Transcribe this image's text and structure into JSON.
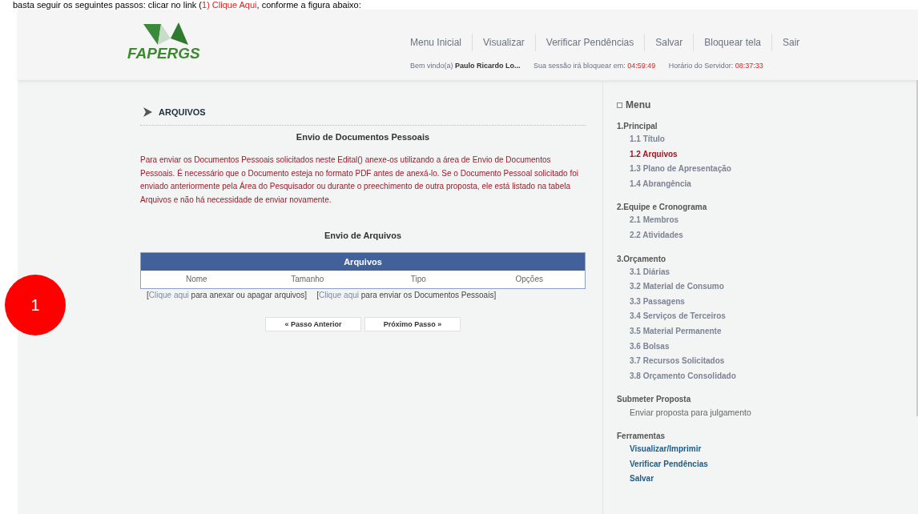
{
  "caption": {
    "before": "basta seguir os seguintes passos: clicar no link (",
    "link": "1) Clique Aqui",
    "after": ", conforme a figura abaixo:"
  },
  "header": {
    "logo": "FAPERGS",
    "nav": [
      "Menu Inicial",
      "Visualizar",
      "Verificar Pendências",
      "Salvar",
      "Bloquear tela",
      "Sair"
    ],
    "welcome_label": "Bem vindo(a)",
    "user": "Paulo Ricardo Lo...",
    "session_label": "Sua sessão irá bloquear em:",
    "session_time": "04:59:49",
    "server_label": "Horário do Servidor:",
    "server_time": "08:37:33"
  },
  "main": {
    "section_title": "ARQUIVOS",
    "subtitle": "Envio de Documentos Pessoais",
    "notice": "Para enviar os Documentos Pessoais solicitados neste Edital() anexe-os utilizando a área de Envio de Documentos Pessoais. É necessário que o Documento esteja no formato PDF antes de anexá-lo. Se o Documento Pessoal solicitado foi enviado anteriormente pela Área do Pesquisador ou durante o preechimento de outra proposta, ele está listado na tabela Arquivos e não há necessidade de enviar novamente.",
    "files_title": "Envio de Arquivos",
    "table": {
      "title": "Arquivos",
      "columns": [
        "Nome",
        "Tamanho",
        "Tipo",
        "Opções"
      ]
    },
    "links": [
      {
        "open": "[",
        "link": "Clique aqui",
        "text": " para anexar ou apagar arquivos]"
      },
      {
        "open": "[",
        "link": "Clique aqui",
        "text": " para enviar os Documentos Pessoais]"
      }
    ],
    "buttons": [
      "« Passo Anterior",
      "Próximo Passo »"
    ]
  },
  "sidebar": {
    "title": "Menu",
    "groups": [
      {
        "label": "1.Principal",
        "items": [
          {
            "label": "1.1 Título",
            "kind": "step",
            "selected": false
          },
          {
            "label": "1.2 Arquivos",
            "kind": "step",
            "selected": true
          },
          {
            "label": "1.3 Plano de Apresentação",
            "kind": "step",
            "selected": false
          },
          {
            "label": "1.4 Abrangência",
            "kind": "step",
            "selected": false
          }
        ]
      },
      {
        "label": "2.Equipe e Cronograma",
        "items": [
          {
            "label": "2.1 Membros",
            "kind": "step",
            "selected": false
          },
          {
            "label": "2.2 Atividades",
            "kind": "step",
            "selected": false
          }
        ]
      },
      {
        "label": "3.Orçamento",
        "items": [
          {
            "label": "3.1 Diárias",
            "kind": "step",
            "selected": false
          },
          {
            "label": "3.2 Material de Consumo",
            "kind": "step",
            "selected": false
          },
          {
            "label": "3.3 Passagens",
            "kind": "step",
            "selected": false
          },
          {
            "label": "3.4 Serviços de Terceiros",
            "kind": "step",
            "selected": false
          },
          {
            "label": "3.5 Material Permanente",
            "kind": "step",
            "selected": false
          },
          {
            "label": "3.6 Bolsas",
            "kind": "step",
            "selected": false
          },
          {
            "label": "3.7 Recursos Solicitados",
            "kind": "step",
            "selected": false
          },
          {
            "label": "3.8 Orçamento Consolidado",
            "kind": "step",
            "selected": false
          }
        ]
      },
      {
        "label": "Submeter Proposta",
        "items": [
          {
            "label": "Enviar proposta para julgamento",
            "kind": "action",
            "selected": false
          }
        ]
      },
      {
        "label": "Ferramentas",
        "items": [
          {
            "label": "Visualizar/Imprimir",
            "kind": "tool",
            "selected": false
          },
          {
            "label": "Verificar Pendências",
            "kind": "tool",
            "selected": false
          },
          {
            "label": "Salvar",
            "kind": "tool",
            "selected": false
          }
        ]
      }
    ]
  },
  "marker": "1"
}
